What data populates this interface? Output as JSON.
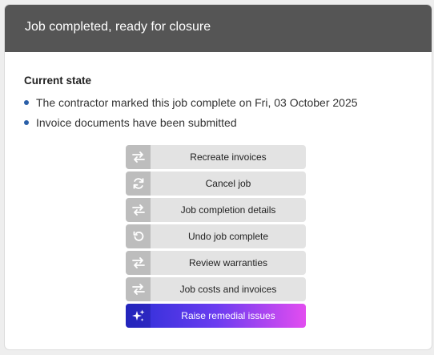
{
  "header": {
    "title": "Job completed, ready for closure"
  },
  "current_state": {
    "title": "Current state",
    "items": [
      "The contractor marked this job complete on Fri, 03 October 2025",
      "Invoice documents have been submitted"
    ]
  },
  "actions": [
    {
      "label": "Recreate invoices",
      "icon": "swap-arrows-icon"
    },
    {
      "label": "Cancel job",
      "icon": "refresh-icon"
    },
    {
      "label": "Job completion details",
      "icon": "swap-arrows-icon"
    },
    {
      "label": "Undo job complete",
      "icon": "undo-icon"
    },
    {
      "label": "Review warranties",
      "icon": "swap-arrows-icon"
    },
    {
      "label": "Job costs and invoices",
      "icon": "swap-arrows-icon"
    },
    {
      "label": "Raise remedial issues",
      "icon": "sparkle-icon",
      "style": "primary"
    }
  ],
  "colors": {
    "header_bg": "#555555",
    "bullet": "#2a5fa8",
    "button_bg": "#e3e3e3",
    "icon_bg": "#bdbdbd",
    "primary_gradient": [
      "#2b2fd6",
      "#6a3cf0",
      "#e24df0"
    ]
  }
}
